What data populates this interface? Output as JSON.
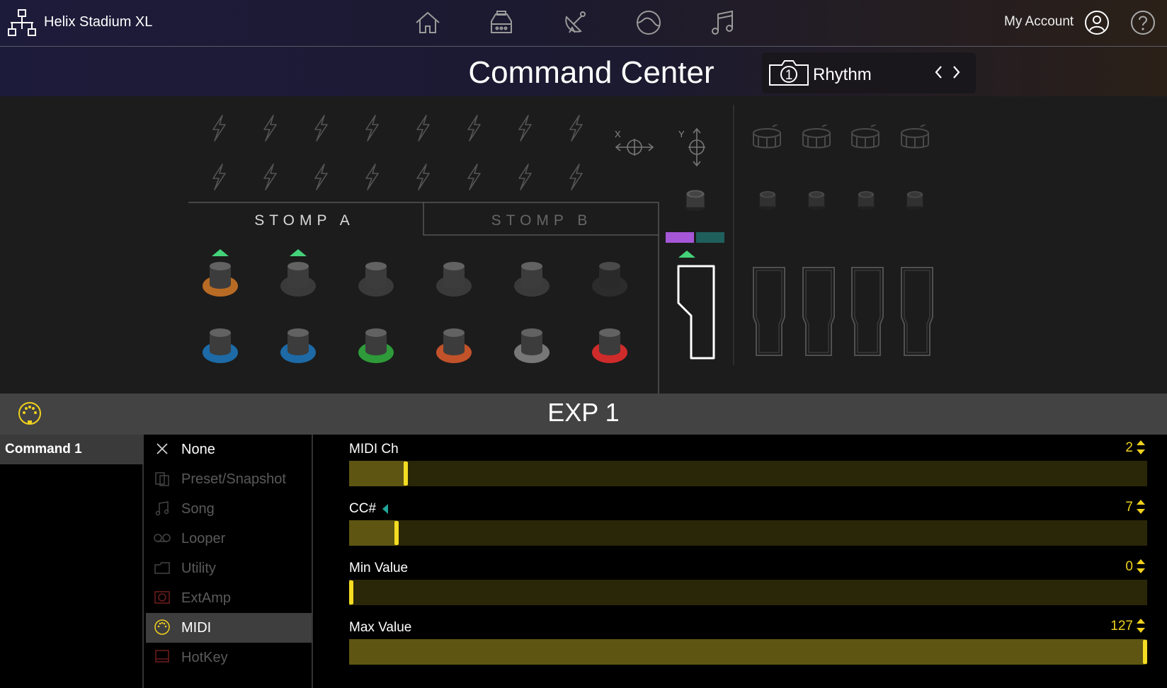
{
  "topbar": {
    "app_title": "Helix Stadium XL",
    "nav_icons": [
      "home-icon",
      "amp-icon",
      "satellite-icon",
      "tone-icon",
      "music-note-icon"
    ],
    "account_label": "My Account"
  },
  "header": {
    "title": "Command Center",
    "preset": {
      "number": "1",
      "name": "Rhythm"
    }
  },
  "stage": {
    "tabs": [
      {
        "label": "STOMP A",
        "active": true
      },
      {
        "label": "STOMP B",
        "active": false
      }
    ],
    "xy_labels": {
      "x": "X",
      "y": "Y"
    },
    "footswitch_rings_top": [
      "#b86b24",
      "#3a3a3a",
      "#3a3a3a",
      "#3a3a3a",
      "#3a3a3a",
      "#2c2c2c"
    ],
    "footswitch_rings_bottom": [
      "#1d6aa6",
      "#1d6aa6",
      "#2e9a3a",
      "#c2522a",
      "#777777",
      "#d02b2b"
    ],
    "indicator_colors": [
      "#a657d8",
      "#1f5f5c"
    ],
    "accent_green": "#44d27a"
  },
  "exp": {
    "title": "EXP 1"
  },
  "commands": {
    "selected": "Command 1"
  },
  "categories": [
    {
      "label": "None",
      "icon": "close-icon",
      "enabled": true
    },
    {
      "label": "Preset/Snapshot",
      "icon": "preset-icon",
      "enabled": false
    },
    {
      "label": "Song",
      "icon": "music-note-icon",
      "enabled": false
    },
    {
      "label": "Looper",
      "icon": "looper-icon",
      "enabled": false
    },
    {
      "label": "Utility",
      "icon": "utility-icon",
      "enabled": false
    },
    {
      "label": "ExtAmp",
      "icon": "ext-amp-icon",
      "enabled": false
    },
    {
      "label": "MIDI",
      "icon": "midi-icon",
      "enabled": true,
      "selected": true
    },
    {
      "label": "HotKey",
      "icon": "hotkey-icon",
      "enabled": false
    }
  ],
  "params": [
    {
      "label": "MIDI Ch",
      "value": "2",
      "fraction": 0.069
    },
    {
      "label": "CC#",
      "value": "7",
      "fraction": 0.057
    },
    {
      "label": "Min Value",
      "value": "0",
      "fraction": 0.0
    },
    {
      "label": "Max Value",
      "value": "127",
      "fraction": 1.0
    }
  ],
  "colors": {
    "accent_yellow": "#f0d11d",
    "slider_fill": "#5e5512",
    "slider_track": "#2a2608"
  }
}
